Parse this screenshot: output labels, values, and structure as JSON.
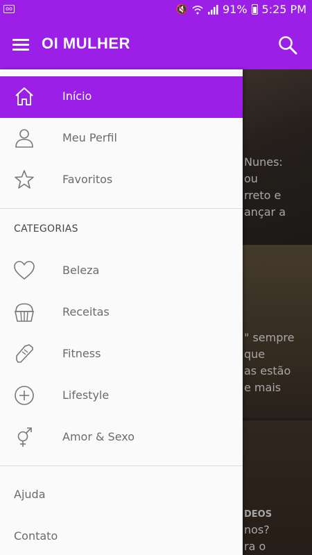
{
  "status_bar": {
    "battery": "91%",
    "time": "5:25 PM"
  },
  "app_bar": {
    "title": "OI MULHER"
  },
  "drawer": {
    "main_items": [
      {
        "label": "Início",
        "icon": "home-icon",
        "active": true
      },
      {
        "label": "Meu Perfil",
        "icon": "user-icon",
        "active": false
      },
      {
        "label": "Favoritos",
        "icon": "star-icon",
        "active": false
      }
    ],
    "categories_header": "CATEGORIAS",
    "categories": [
      {
        "label": "Beleza",
        "icon": "heart-icon"
      },
      {
        "label": "Receitas",
        "icon": "cupcake-icon"
      },
      {
        "label": "Fitness",
        "icon": "sneaker-icon"
      },
      {
        "label": "Lifestyle",
        "icon": "plus-circle-icon"
      },
      {
        "label": "Amor & Sexo",
        "icon": "gender-icon"
      }
    ],
    "footer_items": [
      "Ajuda",
      "Contato"
    ]
  },
  "background_cards": [
    {
      "lines": [
        "Nunes:",
        "ou",
        "rreto e",
        "ançar a"
      ]
    },
    {
      "lines": [
        "\" sempre",
        "que",
        "as estão",
        "e mais"
      ]
    },
    {
      "lines": [
        "DEOS",
        "nos?",
        "ra o"
      ]
    }
  ],
  "colors": {
    "accent": "#9c1fe8",
    "drawer_bg": "#fafafa",
    "text_muted": "#6b6b6b"
  }
}
